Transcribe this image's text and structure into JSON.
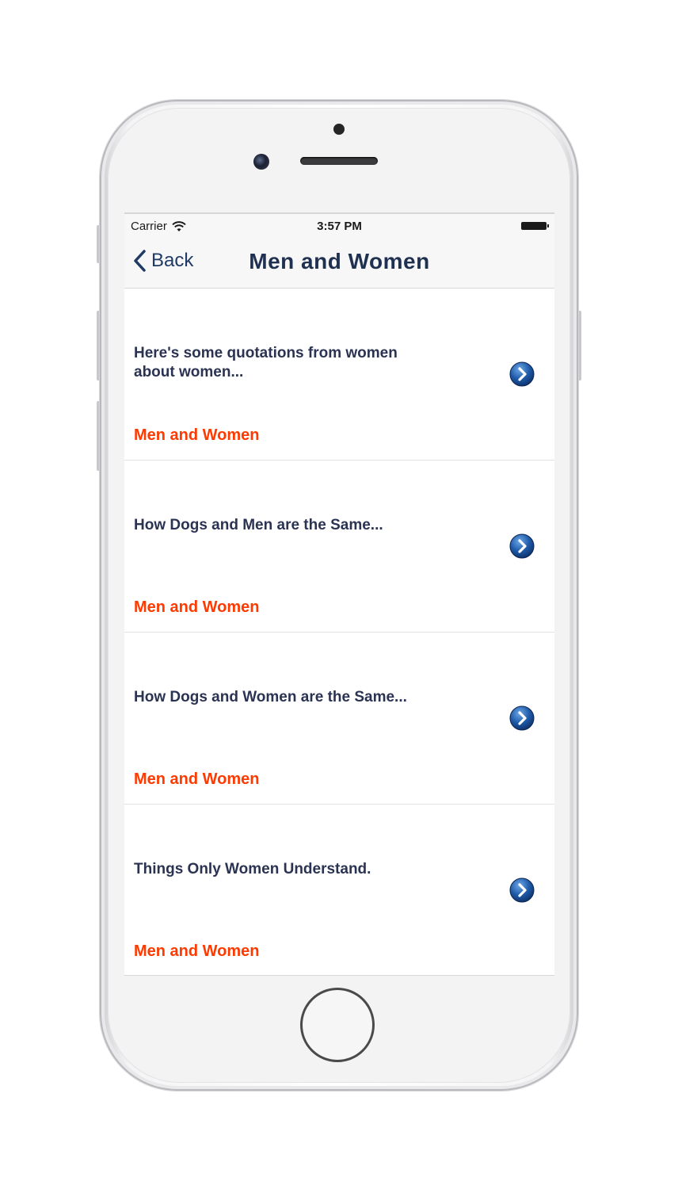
{
  "status_bar": {
    "carrier": "Carrier",
    "time": "3:57 PM"
  },
  "nav": {
    "back_label": "Back",
    "title": "Men and Women"
  },
  "items": [
    {
      "title": "Here's some quotations from women about women...",
      "category": "Men and Women"
    },
    {
      "title": "How Dogs and Men are the Same...",
      "category": "Men and Women"
    },
    {
      "title": "How Dogs and Women are the Same...",
      "category": "Men and Women"
    },
    {
      "title": "Things Only Women Understand.",
      "category": "Men and Women"
    }
  ],
  "colors": {
    "accent": "#ff3a00",
    "title_text": "#2b3352",
    "nav_tint": "#1f3a64",
    "disclosure": "#1e5aa8"
  },
  "icons": {
    "back": "chevron-left-icon",
    "row_disclosure": "chevron-right-circle-icon",
    "wifi": "wifi-icon",
    "battery": "battery-icon"
  }
}
